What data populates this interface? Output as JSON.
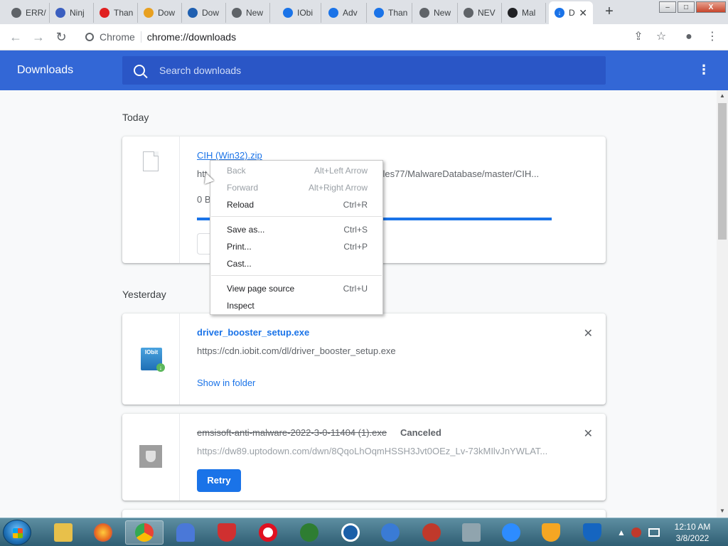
{
  "browser": {
    "tabs": [
      {
        "label": "ERR/",
        "color": "#5f6368"
      },
      {
        "label": "Ninj",
        "color": "#3b5fc0"
      },
      {
        "label": "Than",
        "color": "#e02020"
      },
      {
        "label": "Dow",
        "color": "#e8a020"
      },
      {
        "label": "Dow",
        "color": "#1f5fb0"
      },
      {
        "label": "New",
        "color": "#5f6368"
      },
      {
        "label": "IObi",
        "color": "#1a73e8"
      },
      {
        "label": "Adv",
        "color": "#1a73e8"
      },
      {
        "label": "Than",
        "color": "#1a73e8"
      },
      {
        "label": "New",
        "color": "#5f6368"
      },
      {
        "label": "NEV",
        "color": "#5f6368"
      },
      {
        "label": "Mal",
        "color": "#202124"
      },
      {
        "label": "D",
        "color": "#1a73e8"
      }
    ],
    "new_tab_symbol": "+",
    "window_controls": {
      "minimize": "–",
      "maximize": "□",
      "close": "X"
    },
    "omnibox": {
      "site_label": "Chrome",
      "url": "chrome://downloads"
    },
    "nav": {
      "back": "←",
      "forward": "→",
      "reload": "↻"
    },
    "toolbar_icons": {
      "share": "⇪",
      "bookmark": "☆",
      "profile": "●",
      "menu": "⋮"
    }
  },
  "downloads": {
    "title": "Downloads",
    "search_placeholder": "Search downloads",
    "menu_icon": "⋮",
    "sections": [
      {
        "label": "Today",
        "items": [
          {
            "filename": "CIH (Win32).zip",
            "url_start": "htt",
            "url_end": "obles77/MalwareDatabase/master/CIH...",
            "size_text": "0 B",
            "progress_percent": 100
          }
        ]
      },
      {
        "label": "Yesterday",
        "items": [
          {
            "filename": "driver_booster_setup.exe",
            "url": "https://cdn.iobit.com/dl/driver_booster_setup.exe",
            "action": "Show in folder",
            "icon_text": "IObit"
          },
          {
            "filename": "emsisoft-anti-malware-2022-3-0-11404 (1).exe",
            "status": "Canceled",
            "url": "https://dw89.uptodown.com/dwn/8QqoLhOqmHSSH3Jvt0OEz_Lv-73kMIlvJnYWLAT...",
            "action": "Retry"
          }
        ]
      }
    ],
    "remove_symbol": "✕"
  },
  "context_menu": {
    "items": [
      {
        "label": "Back",
        "shortcut": "Alt+Left Arrow",
        "disabled": true
      },
      {
        "label": "Forward",
        "shortcut": "Alt+Right Arrow",
        "disabled": true
      },
      {
        "label": "Reload",
        "shortcut": "Ctrl+R",
        "disabled": false
      },
      {
        "label": "Save as...",
        "shortcut": "Ctrl+S",
        "disabled": false
      },
      {
        "label": "Print...",
        "shortcut": "Ctrl+P",
        "disabled": false
      },
      {
        "label": "Cast...",
        "shortcut": "",
        "disabled": false
      },
      {
        "label": "View page source",
        "shortcut": "Ctrl+U",
        "disabled": false
      },
      {
        "label": "Inspect",
        "shortcut": "",
        "disabled": false
      }
    ]
  },
  "taskbar": {
    "apps": [
      {
        "name": "file-explorer",
        "color": "#e8c04a"
      },
      {
        "name": "firefox",
        "color": "#e86a1f"
      },
      {
        "name": "chrome",
        "color": "#4caf50"
      },
      {
        "name": "app-blue-flame",
        "color": "#4a78d8"
      },
      {
        "name": "security-suite",
        "color": "#d03030"
      },
      {
        "name": "opera",
        "color": "#e01020"
      },
      {
        "name": "shield-app",
        "color": "#2e7d32"
      },
      {
        "name": "ccleaner",
        "color": "#1a5fa8"
      },
      {
        "name": "cloud-app",
        "color": "#3a7bd5"
      },
      {
        "name": "virus-app",
        "color": "#c0392b"
      },
      {
        "name": "monitor-app",
        "color": "#90a4ae"
      },
      {
        "name": "zoom",
        "color": "#2d8cff"
      },
      {
        "name": "avast-shield",
        "color": "#f5a623"
      },
      {
        "name": "defender-shield",
        "color": "#1565c0"
      }
    ],
    "time": "12:10 AM",
    "date": "3/8/2022"
  }
}
